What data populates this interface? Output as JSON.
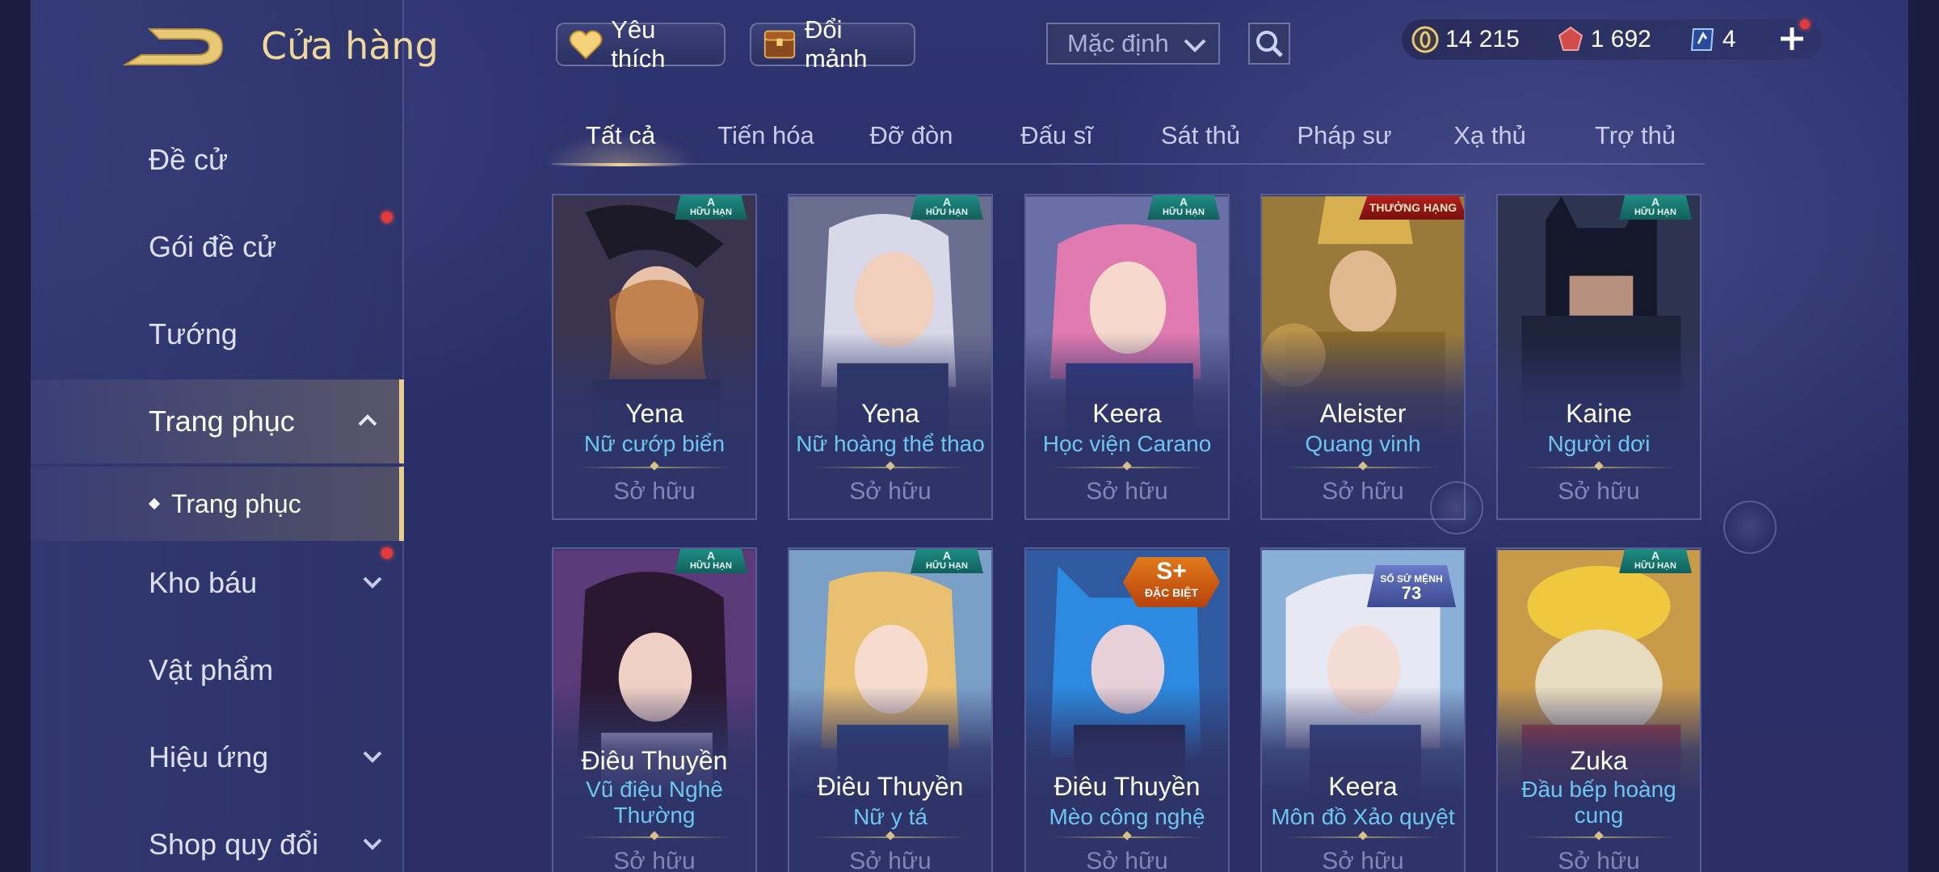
{
  "header": {
    "title": "Cửa hàng",
    "favorites_label": "Yêu thích",
    "exchange_label": "Đổi mảnh",
    "sort_value": "Mặc định"
  },
  "currency": [
    {
      "icon": "gold-coin-icon",
      "value": "14 215"
    },
    {
      "icon": "red-gem-icon",
      "value": "1 692"
    },
    {
      "icon": "voucher-icon",
      "value": "4"
    }
  ],
  "sidebar": {
    "items": [
      {
        "label": "Đề cử"
      },
      {
        "label": "Gói đề cử"
      },
      {
        "label": "Tướng"
      },
      {
        "label": "Trang phục"
      },
      {
        "label": "Kho báu"
      },
      {
        "label": "Vật phẩm"
      },
      {
        "label": "Hiệu ứng"
      },
      {
        "label": "Shop quy đổi"
      }
    ],
    "sub_item": "Trang phục"
  },
  "tabs": [
    "Tất cả",
    "Tiến hóa",
    "Đỡ đòn",
    "Đấu sĩ",
    "Sát thủ",
    "Pháp sư",
    "Xạ thủ",
    "Trợ thủ"
  ],
  "cards": [
    {
      "name": "Yena",
      "skin": "Nữ cướp biển",
      "status": "Sở hữu",
      "badge": "A HỮU HẠN",
      "tone": "#3a3450"
    },
    {
      "name": "Yena",
      "skin": "Nữ hoàng thể thao",
      "status": "Sở hữu",
      "badge": "A HỮU HẠN",
      "tone": "#6a6f90"
    },
    {
      "name": "Keera",
      "skin": "Học viện Carano",
      "status": "Sở hữu",
      "badge": "A HỮU HẠN",
      "tone": "#8a4c86"
    },
    {
      "name": "Aleister",
      "skin": "Quang vinh",
      "status": "Sở hữu",
      "badge": "THƯỞNG HẠNG",
      "tone": "#9a7a3a"
    },
    {
      "name": "Kaine",
      "skin": "Người dơi",
      "status": "Sở hữu",
      "badge": "A HỮU HẠN",
      "tone": "#2c3450"
    },
    {
      "name": "Điêu Thuyền",
      "skin": "Vũ điệu Nghê Thường",
      "status": "Sở hữu",
      "badge": "A HỮU HẠN",
      "tone": "#5a3a78"
    },
    {
      "name": "Điêu Thuyền",
      "skin": "Nữ y tá",
      "status": "Sở hữu",
      "badge": "A HỮU HẠN",
      "tone": "#7aa0c8"
    },
    {
      "name": "Điêu Thuyền",
      "skin": "Mèo công nghệ",
      "status": "Sở hữu",
      "badge": "S+ ĐẶC BIỆT",
      "tone": "#2f5aa0"
    },
    {
      "name": "Keera",
      "skin": "Môn đồ Xảo quyệt",
      "status": "Sở hữu",
      "badge": "SỐ SỬ MỆNH 73",
      "tone": "#8ab0d8"
    },
    {
      "name": "Zuka",
      "skin": "Đầu bếp hoàng cung",
      "status": "Sở hữu",
      "badge": "A HỮU HẠN",
      "tone": "#c89a4a"
    }
  ],
  "badges": {
    "a_top": "A",
    "a_bottom": "HỮU HẠN",
    "rank": "THƯỞNG HẠNG",
    "sp_top": "S+",
    "sp_bottom": "ĐẶC BIỆT",
    "series_top": "SỐ SỬ MỆNH",
    "series_num": "73"
  }
}
